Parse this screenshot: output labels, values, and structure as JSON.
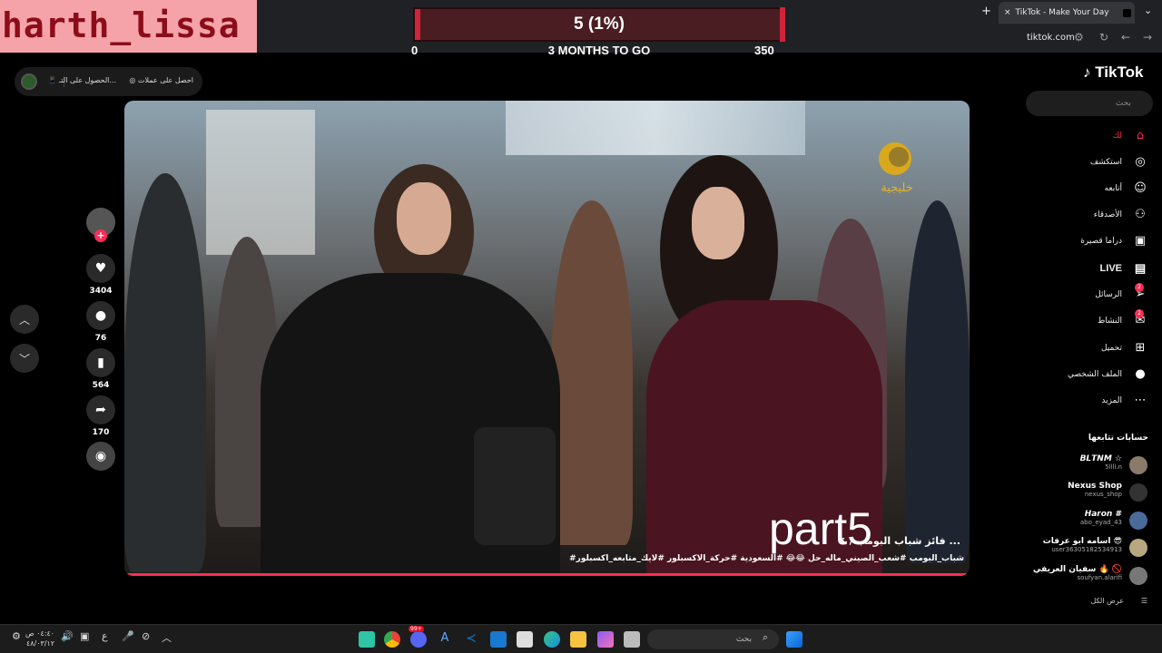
{
  "overlay": {
    "streamer": "harth_lissa",
    "goal": {
      "label": "5 (1%)",
      "start": "0",
      "end": "350",
      "time_left": "3 MONTHS TO GO",
      "progress_fraction": 0.0143,
      "color": "#d0243b"
    }
  },
  "browser": {
    "new_tab": "+",
    "tab_title": "TikTok - Make Your Day",
    "tab_close": "×",
    "url": "tiktok.com"
  },
  "coin_pill": {
    "earn": "احصل على عملات",
    "get": "الحصول على التـ..."
  },
  "video": {
    "watermark": "part5",
    "title": "فائز شباب البومب / ٤ ...",
    "hashtags": "#شباب_البومب #شعب_الصيني_ماله_حل 😂😂 #السعودية #حركة_الاكسبلور #لايك_متابعه_اكسبلور",
    "channel_logo": "خليجية"
  },
  "actions": {
    "likes": "3404",
    "comments": "76",
    "saves": "564",
    "shares": "170"
  },
  "sidebar": {
    "logo": "TikTok",
    "search_placeholder": "بحث",
    "nav": [
      {
        "label": "لك",
        "icon": "home-icon"
      },
      {
        "label": "استكشف",
        "icon": "compass-icon"
      },
      {
        "label": "أتابعه",
        "icon": "following-icon"
      },
      {
        "label": "الأصدقاء",
        "icon": "friends-icon"
      },
      {
        "label": "دراما قصيرة",
        "icon": "drama-icon"
      },
      {
        "label": "LIVE",
        "icon": "live-icon"
      },
      {
        "label": "الرسائل",
        "icon": "messages-icon",
        "badge": "2"
      },
      {
        "label": "النشاط",
        "icon": "activity-icon",
        "badge": "2"
      },
      {
        "label": "تحميل",
        "icon": "upload-icon"
      },
      {
        "label": "الملف الشخصي",
        "icon": "profile-icon"
      },
      {
        "label": "المزيد",
        "icon": "more-icon"
      }
    ],
    "following_title": "حسابات تتابعها",
    "accounts": [
      {
        "name": "𝘽𝙇𝙏𝙉𝙈 ☆",
        "handle": "5llll.n"
      },
      {
        "name": "Nexus Shop",
        "handle": "nexus_shop"
      },
      {
        "name": "𝙃𝙖𝙧𝙤𝙣 #",
        "handle": "abo_eyad_43"
      },
      {
        "name": "اسامه ابو عرفات 😎",
        "handle": "user36305182534913"
      },
      {
        "name": "سفيان العريفي 🔥 🚫",
        "handle": "soufyan.alarifi"
      }
    ],
    "see_all": "عرض الكل"
  },
  "taskbar": {
    "search_placeholder": "بحث",
    "time": "٠٤:٤٠ ص",
    "date": "٤٨/٠٣/١٢",
    "lang": "ع",
    "notif_badge": "99+"
  }
}
